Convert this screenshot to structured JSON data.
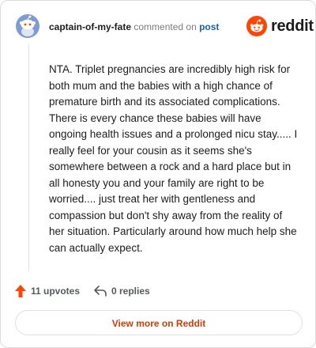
{
  "comment": {
    "username": "captain-of-my-fate",
    "action": "commented on",
    "target_link": "post",
    "body": "NTA. Triplet pregnancies are incredibly high risk for both mum and the babies with a high chance of premature birth and its associated complications. There is every chance these babies will have ongoing health issues and a prolonged nicu stay..... I really feel for your cousin as it seems she's somewhere between a rock and a hard place but in all honesty you and your family are right to be worried.... just treat her with gentleness and compassion but don't shy away from the reality of her situation. Particularly around how much help she can actually expect."
  },
  "brand": {
    "wordmark": "reddit",
    "icon": "reddit-logo-icon",
    "color": "#ff4500"
  },
  "avatar": {
    "icon": "snoo-avatar-icon",
    "color": "#7193ff"
  },
  "footer": {
    "upvotes_label": "11 upvotes",
    "upvote_icon": "upvote-arrow-icon",
    "upvote_color": "#ff4500",
    "replies_label": "0 replies",
    "reply_icon": "reply-arrow-icon",
    "view_more_label": "View more on Reddit",
    "view_more_color": "#d93a00"
  }
}
